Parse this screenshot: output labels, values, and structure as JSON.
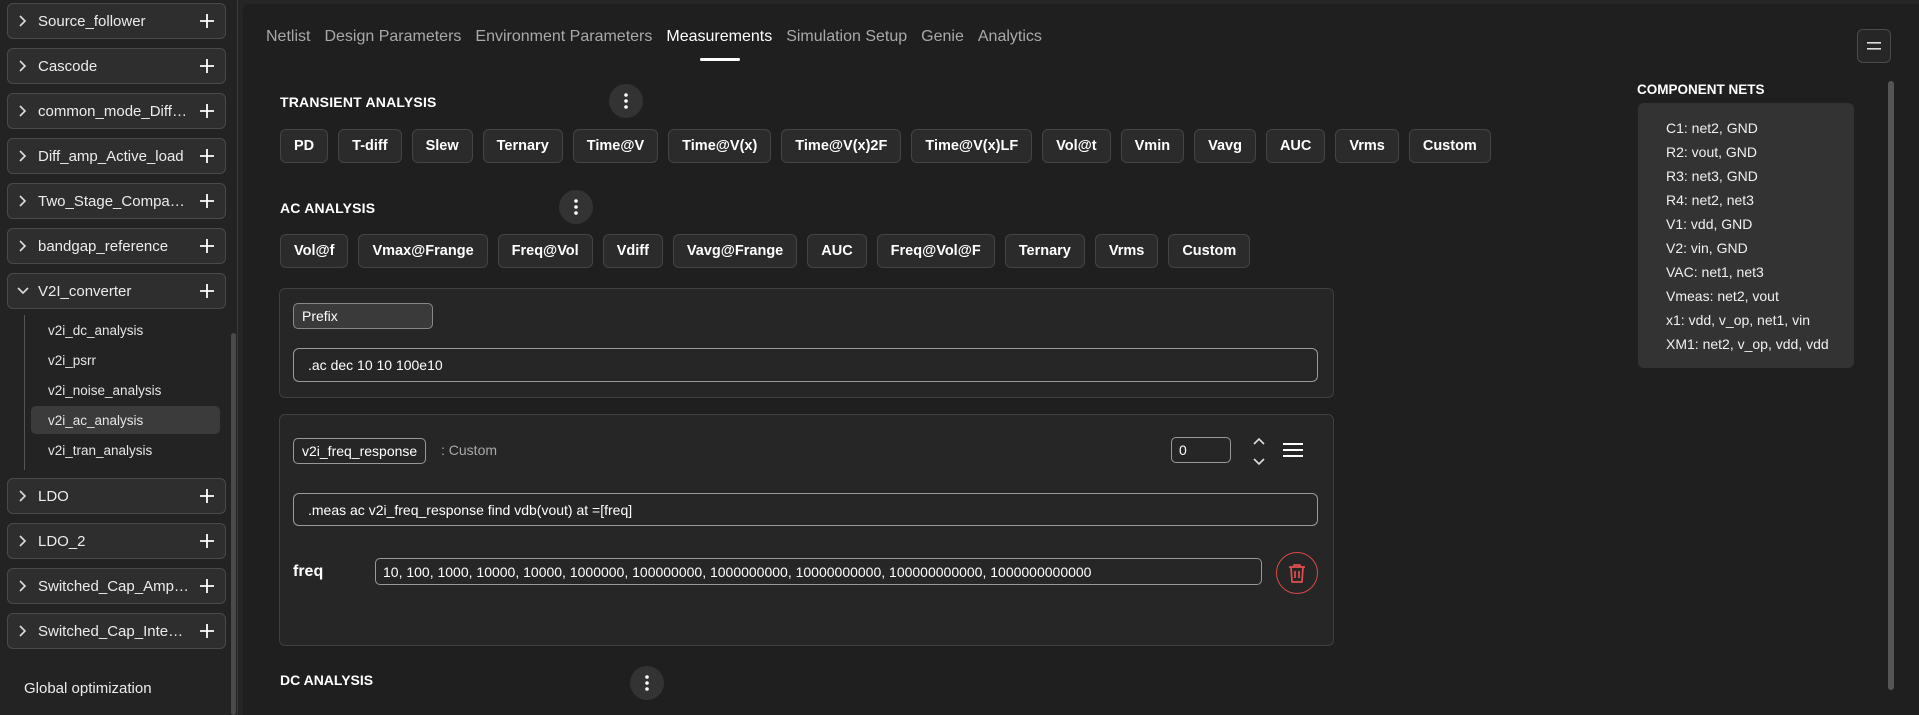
{
  "sidebar": {
    "projects": [
      {
        "name": "Source_follower",
        "expanded": false
      },
      {
        "name": "Cascode",
        "expanded": false
      },
      {
        "name": "common_mode_Diffa...",
        "expanded": false
      },
      {
        "name": "Diff_amp_Active_load",
        "expanded": false
      },
      {
        "name": "Two_Stage_Compara...",
        "expanded": false
      },
      {
        "name": "bandgap_reference",
        "expanded": false
      },
      {
        "name": "V2I_converter",
        "expanded": true
      },
      {
        "name": "LDO",
        "expanded": false
      },
      {
        "name": "LDO_2",
        "expanded": false
      },
      {
        "name": "Switched_Cap_Ampli...",
        "expanded": false
      },
      {
        "name": "Switched_Cap_Integr...",
        "expanded": false
      }
    ],
    "subitems": [
      {
        "label": "v2i_dc_analysis",
        "active": false
      },
      {
        "label": "v2i_psrr",
        "active": false
      },
      {
        "label": "v2i_noise_analysis",
        "active": false
      },
      {
        "label": "v2i_ac_analysis",
        "active": true
      },
      {
        "label": "v2i_tran_analysis",
        "active": false
      }
    ],
    "global_optimization": "Global optimization"
  },
  "tabs": [
    {
      "label": "Netlist",
      "active": false
    },
    {
      "label": "Design Parameters",
      "active": false
    },
    {
      "label": "Environment Parameters",
      "active": false
    },
    {
      "label": "Measurements",
      "active": true
    },
    {
      "label": "Simulation Setup",
      "active": false
    },
    {
      "label": "Genie",
      "active": false
    },
    {
      "label": "Analytics",
      "active": false
    }
  ],
  "transient": {
    "title": "TRANSIENT ANALYSIS",
    "chips": [
      "PD",
      "T-diff",
      "Slew",
      "Ternary",
      "Time@V",
      "Time@V(x)",
      "Time@V(x)2F",
      "Time@V(x)LF",
      "Vol@t",
      "Vmin",
      "Vavg",
      "AUC",
      "Vrms",
      "Custom"
    ]
  },
  "ac": {
    "title": "AC ANALYSIS",
    "chips": [
      "Vol@f",
      "Vmax@Frange",
      "Freq@Vol",
      "Vdiff",
      "Vavg@Frange",
      "AUC",
      "Freq@Vol@F",
      "Ternary",
      "Vrms",
      "Custom"
    ],
    "prefix": {
      "label": "Prefix",
      "value": ".ac dec 10 10 100e10"
    },
    "measurement": {
      "name": "v2i_freq_response",
      "type": ": Custom",
      "order": "0",
      "statement": ".meas ac v2i_freq_response find vdb(vout) at =[freq]",
      "param_label": "freq",
      "param_value": "10, 100, 1000, 10000, 10000, 1000000, 100000000, 1000000000, 10000000000, 100000000000, 1000000000000"
    }
  },
  "dc": {
    "title": "DC ANALYSIS"
  },
  "component_nets": {
    "title": "COMPONENT NETS",
    "items": [
      "C1: net2, GND",
      "R2: vout, GND",
      "R3: net3, GND",
      "R4: net2, net3",
      "V1: vdd, GND",
      "V2: vin, GND",
      "VAC: net1, net3",
      "Vmeas: net2, vout",
      "x1: vdd, v_op, net1, vin",
      "XM1: net2, v_op, vdd, vdd"
    ]
  },
  "colors": {
    "background": "#1f1f1f",
    "sidebar": "#232323",
    "danger": "#d94848",
    "text": "#ffffff"
  }
}
